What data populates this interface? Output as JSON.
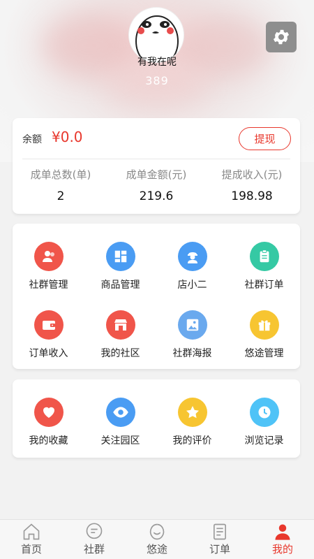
{
  "profile": {
    "name": "有我在呢",
    "id": "389"
  },
  "balance": {
    "label": "余额",
    "value": "¥0.0",
    "withdraw_label": "提现"
  },
  "stats": [
    {
      "label": "成单总数(单)",
      "value": "2"
    },
    {
      "label": "成单金额(元)",
      "value": "219.6"
    },
    {
      "label": "提成收入(元)",
      "value": "198.98"
    }
  ],
  "grid1": [
    {
      "label": "社群管理",
      "icon": "user-group-icon",
      "color": "#f0554a"
    },
    {
      "label": "商品管理",
      "icon": "grid-icon",
      "color": "#4a9cf3"
    },
    {
      "label": "店小二",
      "icon": "clerk-icon",
      "color": "#4a9cf3"
    },
    {
      "label": "社群订单",
      "icon": "clipboard-icon",
      "color": "#35c9a4"
    },
    {
      "label": "订单收入",
      "icon": "wallet-icon",
      "color": "#f0554a"
    },
    {
      "label": "我的社区",
      "icon": "store-icon",
      "color": "#f0554a"
    },
    {
      "label": "社群海报",
      "icon": "image-icon",
      "color": "#6aa9ee"
    },
    {
      "label": "悠途管理",
      "icon": "gift-icon",
      "color": "#f7c531"
    }
  ],
  "grid2": [
    {
      "label": "我的收藏",
      "icon": "heart-icon",
      "color": "#f0554a"
    },
    {
      "label": "关注园区",
      "icon": "eye-icon",
      "color": "#4a9cf3"
    },
    {
      "label": "我的评价",
      "icon": "star-icon",
      "color": "#f7c531"
    },
    {
      "label": "浏览记录",
      "icon": "clock-icon",
      "color": "#4fc3f7"
    }
  ],
  "tabs": [
    {
      "label": "首页",
      "icon": "home-icon"
    },
    {
      "label": "社群",
      "icon": "chat-icon"
    },
    {
      "label": "悠途",
      "icon": "smile-icon"
    },
    {
      "label": "订单",
      "icon": "order-icon"
    },
    {
      "label": "我的",
      "icon": "person-icon",
      "active": true
    }
  ],
  "colors": {
    "accent": "#e8372c",
    "settings_bg": "#8e8e8e"
  }
}
